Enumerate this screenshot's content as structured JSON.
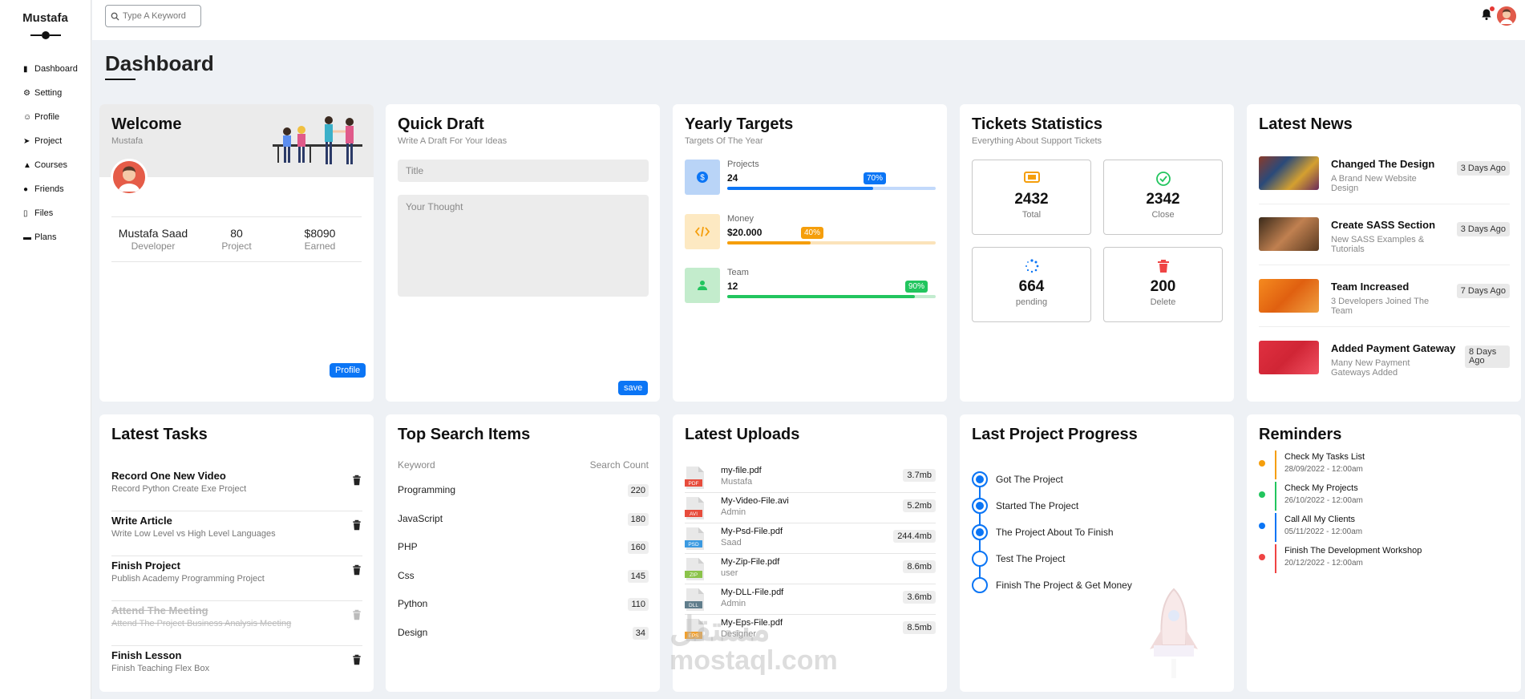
{
  "app": {
    "name": "Mustafa"
  },
  "sidebar": {
    "items": [
      {
        "label": "Dashboard",
        "icon": "chart-bar-icon"
      },
      {
        "label": "Setting",
        "icon": "gear-icon"
      },
      {
        "label": "Profile",
        "icon": "user-icon"
      },
      {
        "label": "Project",
        "icon": "diagram-icon"
      },
      {
        "label": "Courses",
        "icon": "graduation-cap-icon"
      },
      {
        "label": "Friends",
        "icon": "users-icon"
      },
      {
        "label": "Files",
        "icon": "file-icon"
      },
      {
        "label": "Plans",
        "icon": "credit-card-icon"
      }
    ]
  },
  "topbar": {
    "search_placeholder": "Type A Keyword"
  },
  "page": {
    "title": "Dashboard"
  },
  "welcome": {
    "title": "Welcome",
    "user": "Mustafa",
    "name": "Mustafa Saad",
    "role": "Developer",
    "projects": "80",
    "projects_label": "Project",
    "earned": "$8090",
    "earned_label": "Earned",
    "button": "Profile"
  },
  "draft": {
    "title": "Quick Draft",
    "subtitle": "Write A Draft For Your Ideas",
    "title_placeholder": "Title",
    "thought_placeholder": "Your Thought",
    "button": "save"
  },
  "targets": {
    "title": "Yearly Targets",
    "subtitle": "Targets Of The Year",
    "items": [
      {
        "label": "Projects",
        "value": "24",
        "percent": 70,
        "percent_label": "70%",
        "color": "#0b75f5",
        "light": "#c2d9fb",
        "bg": "#b9d4f7"
      },
      {
        "label": "Money",
        "value": "$20.000",
        "percent": 40,
        "percent_label": "40%",
        "color": "#f59e0b",
        "light": "#fbe3ba",
        "bg": "#fde9c2"
      },
      {
        "label": "Team",
        "value": "12",
        "percent": 90,
        "percent_label": "90%",
        "color": "#22c55e",
        "light": "#c2eccf",
        "bg": "#c3eccc"
      }
    ]
  },
  "tickets": {
    "title": "Tickets Statistics",
    "subtitle": "Everything About Support Tickets",
    "items": [
      {
        "value": "2432",
        "label": "Total"
      },
      {
        "value": "2342",
        "label": "Close"
      },
      {
        "value": "664",
        "label": "pending"
      },
      {
        "value": "200",
        "label": "Delete"
      }
    ]
  },
  "news": {
    "title": "Latest News",
    "items": [
      {
        "title": "Changed The Design",
        "desc": "A Brand New Website Design",
        "ago": "3 Days Ago"
      },
      {
        "title": "Create SASS Section",
        "desc": "New SASS Examples & Tutorials",
        "ago": "3 Days Ago"
      },
      {
        "title": "Team Increased",
        "desc": "3 Developers Joined The Team",
        "ago": "7 Days Ago"
      },
      {
        "title": "Added Payment Gateway",
        "desc": "Many New Payment Gateways Added",
        "ago": "8 Days Ago"
      }
    ]
  },
  "tasks": {
    "title": "Latest Tasks",
    "items": [
      {
        "title": "Record One New Video",
        "desc": "Record Python Create Exe Project"
      },
      {
        "title": "Write Article",
        "desc": "Write Low Level vs High Level Languages"
      },
      {
        "title": "Finish Project",
        "desc": "Publish Academy Programming Project"
      },
      {
        "title": "Attend The Meeting",
        "desc": "Attend The Project Business Analysis Meeting"
      },
      {
        "title": "Finish Lesson",
        "desc": "Finish Teaching Flex Box"
      }
    ]
  },
  "search": {
    "title": "Top Search Items",
    "col_keyword": "Keyword",
    "col_count": "Search Count",
    "items": [
      {
        "keyword": "Programming",
        "count": "220"
      },
      {
        "keyword": "JavaScript",
        "count": "180"
      },
      {
        "keyword": "PHP",
        "count": "160"
      },
      {
        "keyword": "Css",
        "count": "145"
      },
      {
        "keyword": "Python",
        "count": "110"
      },
      {
        "keyword": "Design",
        "count": "34"
      }
    ]
  },
  "uploads": {
    "title": "Latest Uploads",
    "items": [
      {
        "name": "my-file.pdf",
        "owner": "Mustafa",
        "size": "3.7mb",
        "type": "PDF",
        "color": "#e74c3c"
      },
      {
        "name": "My-Video-File.avi",
        "owner": "Admin",
        "size": "5.2mb",
        "type": "AVI",
        "color": "#e74c3c"
      },
      {
        "name": "My-Psd-File.pdf",
        "owner": "Saad",
        "size": "244.4mb",
        "type": "PSD",
        "color": "#3b9ae1"
      },
      {
        "name": "My-Zip-File.pdf",
        "owner": "user",
        "size": "8.6mb",
        "type": "ZIP",
        "color": "#8bc34a"
      },
      {
        "name": "My-DLL-File.pdf",
        "owner": "Admin",
        "size": "3.6mb",
        "type": "DLL",
        "color": "#607d8b"
      },
      {
        "name": "My-Eps-File.pdf",
        "owner": "Designer",
        "size": "8.5mb",
        "type": "EPS",
        "color": "#f0a030"
      }
    ]
  },
  "progress": {
    "title": "Last Project Progress",
    "items": [
      {
        "label": "Got The Project",
        "done": true
      },
      {
        "label": "Started The Project",
        "done": true
      },
      {
        "label": "The Project About To Finish",
        "done": true
      },
      {
        "label": "Test The Project",
        "done": false
      },
      {
        "label": "Finish The Project & Get Money",
        "done": false
      }
    ]
  },
  "reminders": {
    "title": "Reminders",
    "items": [
      {
        "title": "Check My Tasks List",
        "date": "28/09/2022 - 12:00am",
        "color": "#f59e0b"
      },
      {
        "title": "Check My Projects",
        "date": "26/10/2022 - 12:00am",
        "color": "#22c55e"
      },
      {
        "title": "Call All My Clients",
        "date": "05/11/2022 - 12:00am",
        "color": "#0b75f5"
      },
      {
        "title": "Finish The Development Workshop",
        "date": "20/12/2022 - 12:00am",
        "color": "#ef4444"
      }
    ]
  },
  "watermark": {
    "brand": "مستقل",
    "site": "mostaql.com"
  }
}
